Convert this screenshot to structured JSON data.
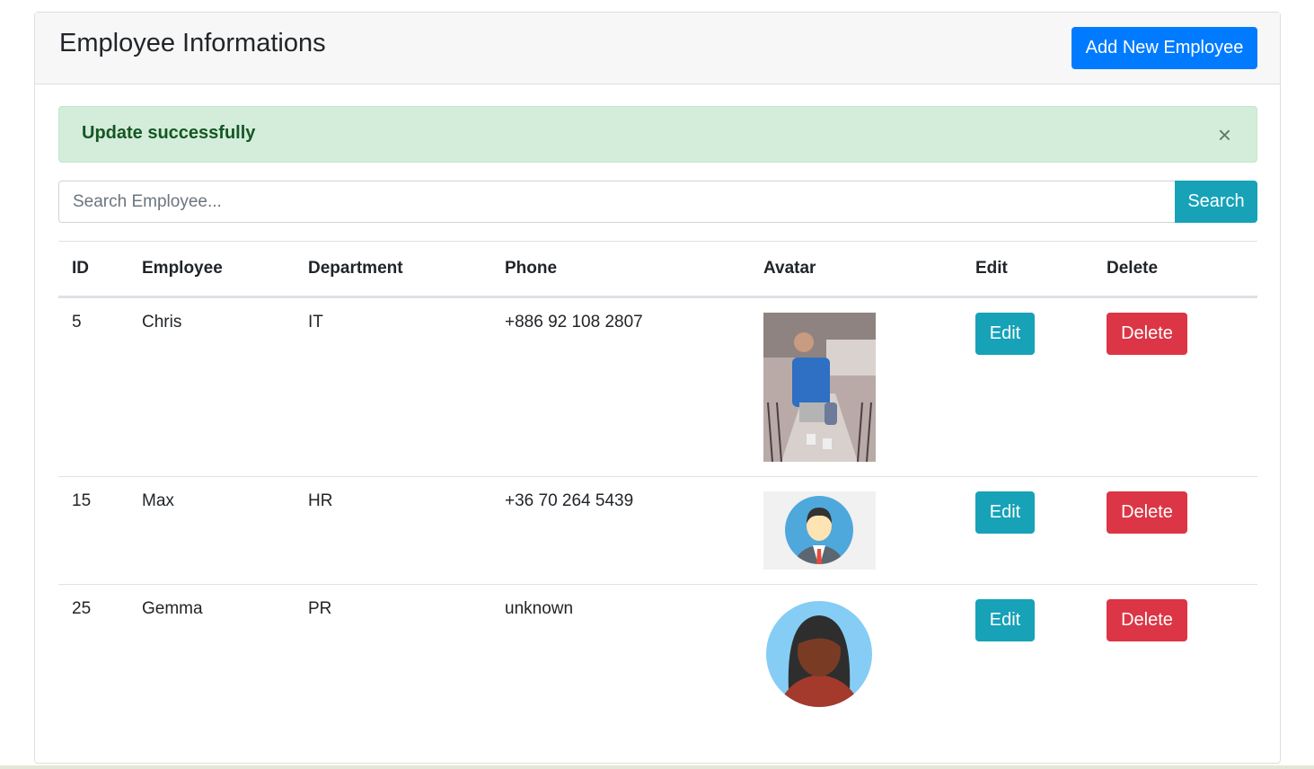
{
  "header": {
    "title": "Employee Informations",
    "add_label": "Add New Employee"
  },
  "alert": {
    "message": "Update successfully",
    "close": "×"
  },
  "search": {
    "placeholder": "Search Employee...",
    "button": "Search"
  },
  "table": {
    "columns": [
      "ID",
      "Employee",
      "Department",
      "Phone",
      "Avatar",
      "Edit",
      "Delete"
    ],
    "rows": [
      {
        "id": "5",
        "name": "Chris",
        "dept": "IT",
        "phone": "+886 92 108 2807",
        "avatar": "photo",
        "edit": "Edit",
        "delete": "Delete"
      },
      {
        "id": "15",
        "name": "Max",
        "dept": "HR",
        "phone": "+36 70 264 5439",
        "avatar": "male-avatar",
        "edit": "Edit",
        "delete": "Delete"
      },
      {
        "id": "25",
        "name": "Gemma",
        "dept": "PR",
        "phone": "unknown",
        "avatar": "female-avatar",
        "edit": "Edit",
        "delete": "Delete"
      }
    ]
  }
}
